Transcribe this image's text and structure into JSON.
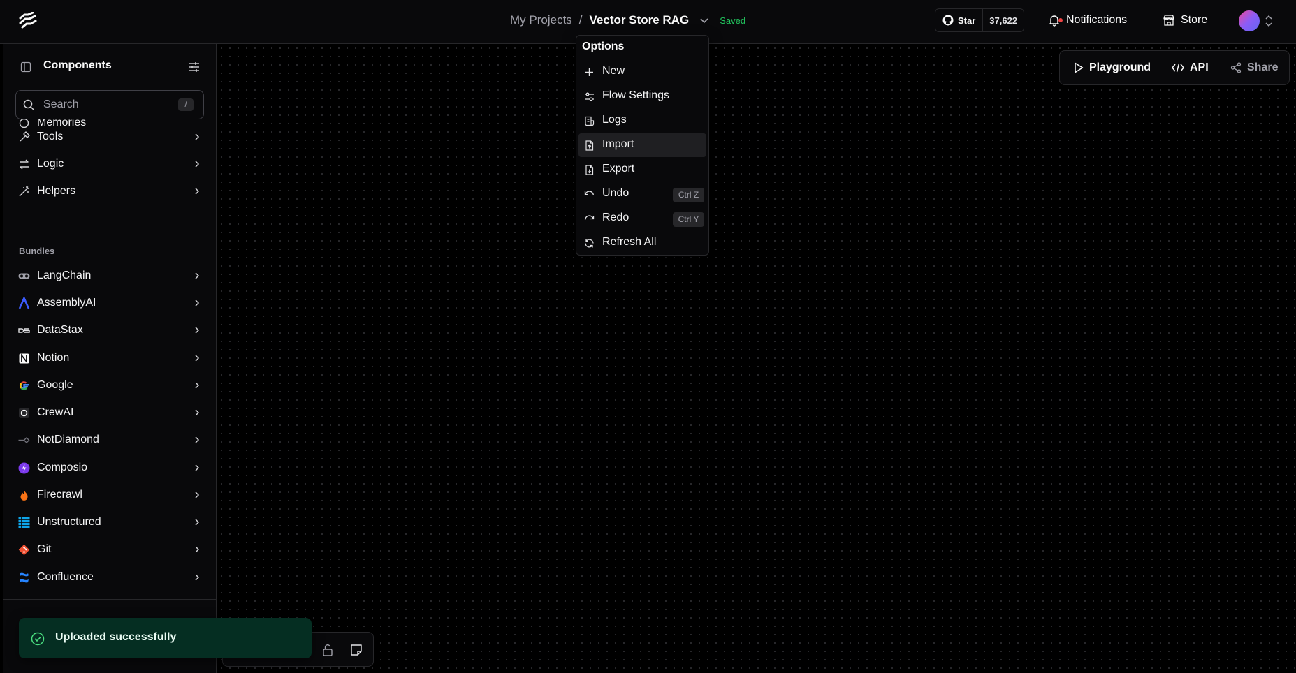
{
  "header": {
    "breadcrumb_root": "My Projects",
    "breadcrumb_sep": "/",
    "flow_name": "Vector Store RAG",
    "save_status": "Saved",
    "github_star_label": "Star",
    "github_star_count": "37,622",
    "notifications_label": "Notifications",
    "store_label": "Store"
  },
  "sidebar": {
    "title": "Components",
    "search_placeholder": "Search",
    "search_shortcut": "/",
    "partial_item": "Memories",
    "items": [
      {
        "label": "Tools",
        "icon": "hammer-icon"
      },
      {
        "label": "Logic",
        "icon": "arrows-icon"
      },
      {
        "label": "Helpers",
        "icon": "wand-icon"
      }
    ],
    "bundles_title": "Bundles",
    "bundles": [
      {
        "label": "LangChain",
        "icon": "langchain-icon"
      },
      {
        "label": "AssemblyAI",
        "icon": "assemblyai-icon"
      },
      {
        "label": "DataStax",
        "icon": "datastax-icon"
      },
      {
        "label": "Notion",
        "icon": "notion-icon"
      },
      {
        "label": "Google",
        "icon": "google-icon"
      },
      {
        "label": "CrewAI",
        "icon": "crewai-icon"
      },
      {
        "label": "NotDiamond",
        "icon": "notdiamond-icon"
      },
      {
        "label": "Composio",
        "icon": "composio-icon"
      },
      {
        "label": "Firecrawl",
        "icon": "firecrawl-icon"
      },
      {
        "label": "Unstructured",
        "icon": "unstructured-icon"
      },
      {
        "label": "Git",
        "icon": "git-icon"
      },
      {
        "label": "Confluence",
        "icon": "confluence-icon"
      }
    ]
  },
  "canvas_actions": {
    "playground": "Playground",
    "api": "API",
    "share": "Share"
  },
  "options_menu": {
    "title": "Options",
    "items": [
      {
        "label": "New",
        "icon": "plus-icon"
      },
      {
        "label": "Flow Settings",
        "icon": "settings-sliders-icon"
      },
      {
        "label": "Logs",
        "icon": "logs-icon"
      },
      {
        "label": "Import",
        "icon": "file-import-icon"
      },
      {
        "label": "Export",
        "icon": "file-export-icon"
      },
      {
        "label": "Undo",
        "icon": "undo-icon",
        "shortcut": "Ctrl Z"
      },
      {
        "label": "Redo",
        "icon": "redo-icon",
        "shortcut": "Ctrl Y"
      },
      {
        "label": "Refresh All",
        "icon": "refresh-icon"
      }
    ],
    "highlighted": "Import"
  },
  "toast": {
    "message": "Uploaded successfully"
  },
  "colors": {
    "background": "#000000",
    "panel": "#09090b",
    "border": "#27272a",
    "saved_green": "#22c55e",
    "toast_bg": "#052e22"
  }
}
